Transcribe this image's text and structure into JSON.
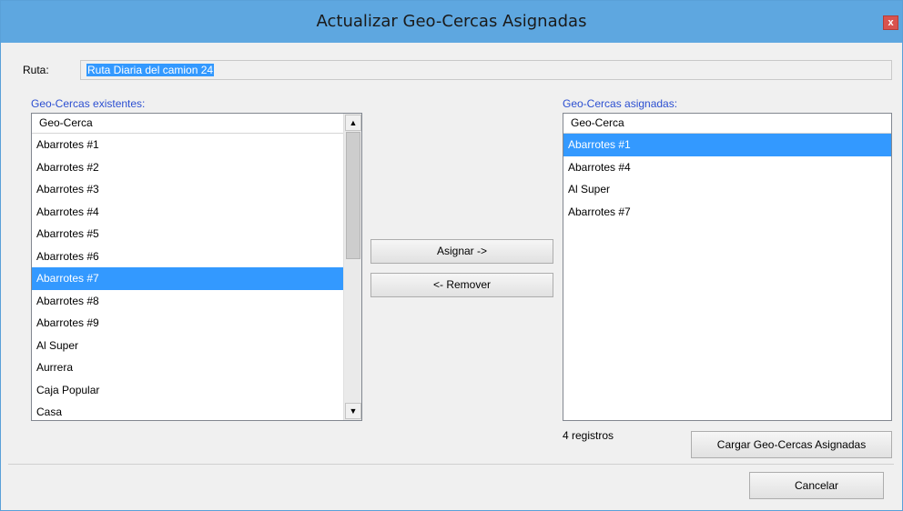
{
  "window": {
    "title": "Actualizar Geo-Cercas Asignadas",
    "close_glyph": "x"
  },
  "ruta": {
    "label": "Ruta:",
    "value": "Ruta Diaria del camion 24"
  },
  "existing": {
    "label": "Geo-Cercas existentes:",
    "header": "Geo-Cerca",
    "items": [
      "Abarrotes #1",
      "Abarrotes #2",
      "Abarrotes #3",
      "Abarrotes #4",
      "Abarrotes #5",
      "Abarrotes #6",
      "Abarrotes #7",
      "Abarrotes #8",
      "Abarrotes #9",
      "Al Super",
      "Aurrera",
      "Caja Popular",
      "Casa"
    ],
    "selected": "Abarrotes #7"
  },
  "assigned": {
    "label": "Geo-Cercas asignadas:",
    "header": "Geo-Cerca",
    "items": [
      "Abarrotes #1",
      "Abarrotes #4",
      "Al Super",
      "Abarrotes #7"
    ],
    "selected": "Abarrotes #1",
    "count_text": "4 registros"
  },
  "buttons": {
    "assign": "Asignar ->",
    "remove": "<- Remover",
    "load": "Cargar Geo-Cercas Asignadas",
    "cancel": "Cancelar"
  },
  "icons": {
    "scroll_up": "▲",
    "scroll_down": "▼"
  },
  "colors": {
    "titlebar": "#5ea7e0",
    "selection": "#3399ff",
    "section_label": "#2c4fd1",
    "close": "#d9534f"
  }
}
